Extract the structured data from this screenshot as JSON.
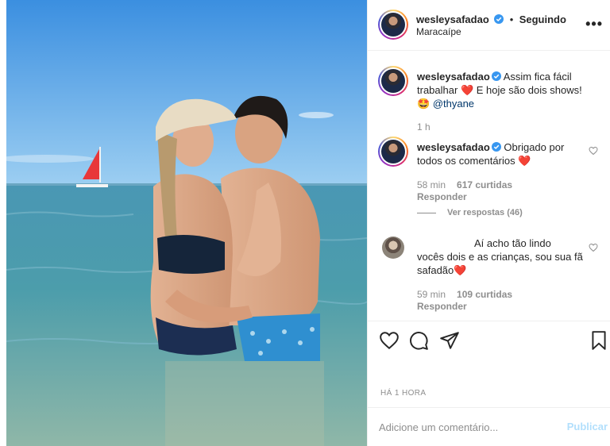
{
  "post": {
    "username": "wesleysafadao",
    "separator": "•",
    "follow_status": "Seguindo",
    "location": "Maracaípe",
    "more_icon": "more-dots-icon",
    "time_ago": "HÁ 1 HORA"
  },
  "caption": {
    "username": "wesleysafadao",
    "text_part1": "Assim fica fácil trabalhar",
    "heart": "❤️",
    "text_part2": "E hoje são dois shows!",
    "emoji": "🤩",
    "mention": "@thyane",
    "time": "1 h"
  },
  "comments": [
    {
      "username": "wesleysafadao",
      "text": "Obrigado por todos os comentários",
      "heart": "❤️",
      "time": "58 min",
      "likes": "617 curtidas",
      "reply": "Responder",
      "view_replies": "Ver respostas (46)"
    },
    {
      "text_line1": "Aí acho tão lindo",
      "text_line2": "vocês dois e as crianças, sou sua fã safadão",
      "heart": "❤️",
      "time": "59 min",
      "likes": "109 curtidas",
      "reply": "Responder"
    }
  ],
  "add_comment": {
    "placeholder": "Adicione um comentário...",
    "publish_label": "Publicar"
  },
  "colors": {
    "verified": "#3897f0",
    "heart": "#ed4956",
    "publish_disabled": "#b2dffc",
    "sky": "#4da3e8",
    "sea": "#3f8fa6"
  }
}
